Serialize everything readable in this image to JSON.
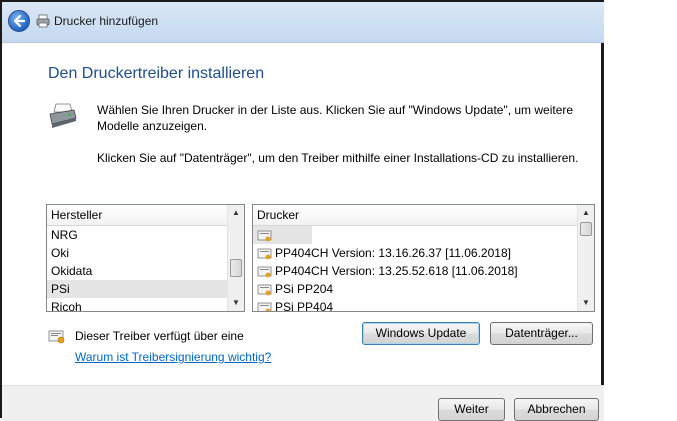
{
  "window": {
    "title": "Drucker hinzufügen",
    "heading": "Den Druckertreiber installieren"
  },
  "instructions": {
    "line1": "Wählen Sie Ihren Drucker in der Liste aus. Klicken Sie auf \"Windows Update\", um weitere Modelle anzuzeigen.",
    "line2": "Klicken Sie auf \"Datenträger\", um den Treiber mithilfe einer Installations-CD zu installieren."
  },
  "manufacturers": {
    "header": "Hersteller",
    "items": [
      "NRG",
      "Oki",
      "Okidata",
      "PSi",
      "Ricoh"
    ],
    "selected": "PSi"
  },
  "printers": {
    "header": "Drucker",
    "items": [
      "",
      "PP404CH Version: 13.16.26.37 [11.06.2018]",
      "PP404CH Version: 13.25.52.618 [11.06.2018]",
      "PSi PP204",
      "PSi PP404"
    ]
  },
  "signature": {
    "note": "Dieser Treiber verfügt über eine",
    "link": "Warum ist Treibersignierung wichtig?"
  },
  "buttons": {
    "windows_update": "Windows Update",
    "datentraeger": "Datenträger...",
    "weiter": "Weiter",
    "abbrechen": "Abbrechen"
  }
}
